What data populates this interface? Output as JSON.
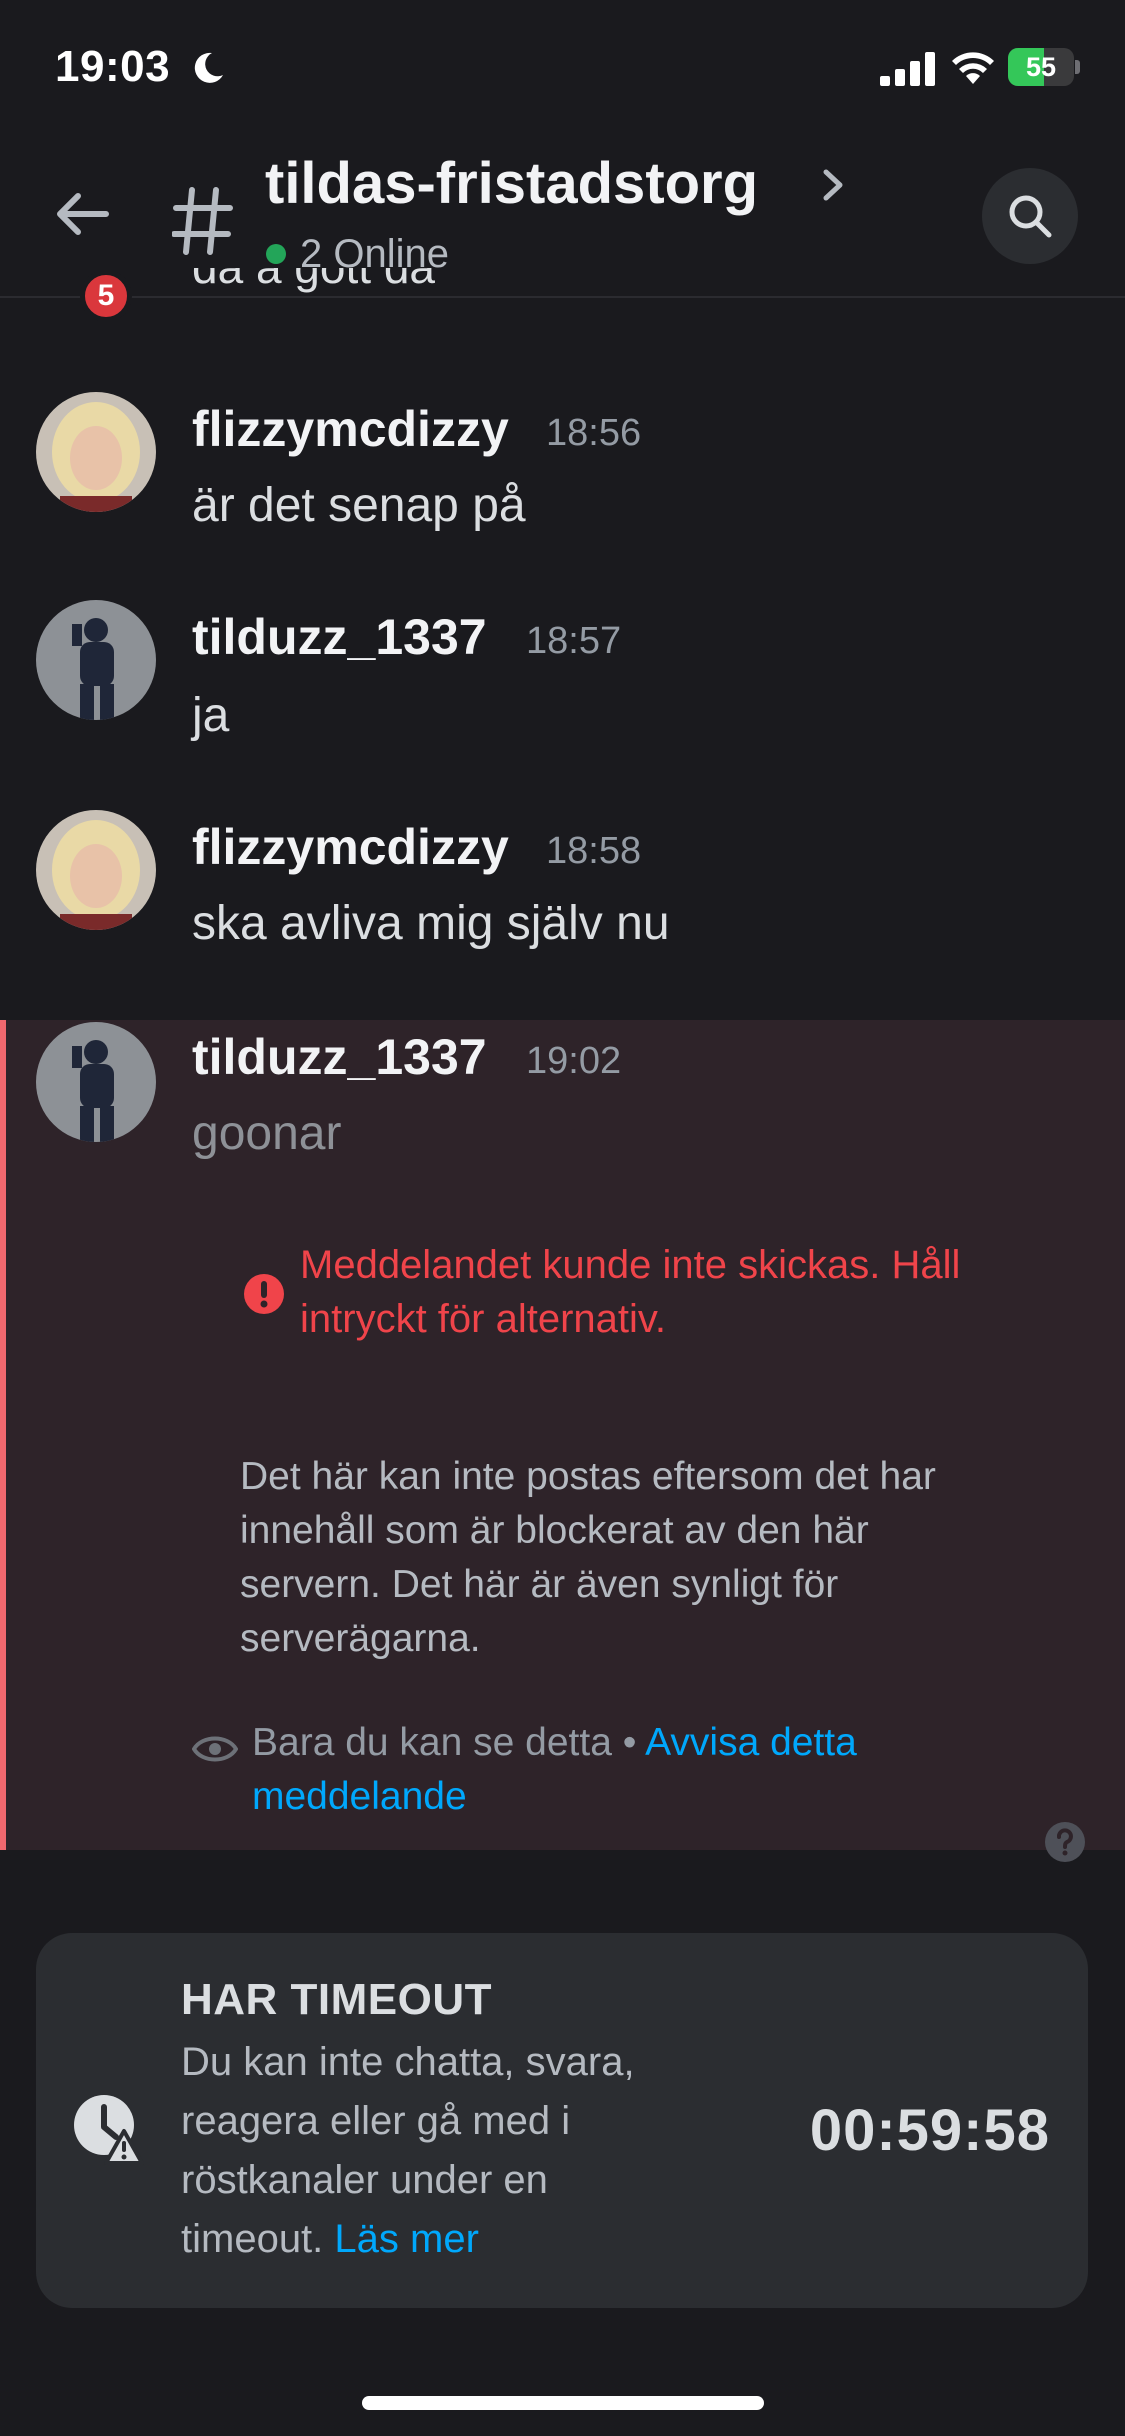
{
  "status_bar": {
    "time": "19:03",
    "battery_percent": "55",
    "battery_level": 0.55,
    "icons": [
      "moon-icon",
      "signal-icon",
      "wifi-icon",
      "battery-icon"
    ]
  },
  "header": {
    "badge_count": "5",
    "channel_name": "tildas-fristadstorg",
    "online_status": "2 Online",
    "colors": {
      "online": "#23a559",
      "badge": "#da373c"
    }
  },
  "messages": {
    "partial_text": "då å gött då",
    "items": [
      {
        "username": "flizzymcdizzy",
        "time": "18:56",
        "text": "är det senap på"
      },
      {
        "username": "tilduzz_1337",
        "time": "18:57",
        "text": "ja"
      },
      {
        "username": "flizzymcdizzy",
        "time": "18:58",
        "text": "ska avliva mig själv nu"
      }
    ],
    "failed": {
      "username": "tilduzz_1337",
      "time": "19:02",
      "text": "goonar",
      "error": "Meddelandet kunde inte skickas. Håll intryckt för alternativ.",
      "blocked_notice": "Det här kan inte postas eftersom det har innehåll som är blockerat av den här servern. Det här är även synligt för serverägarna.",
      "only_you": "Bara du kan se detta •",
      "dismiss_link": "Avvisa detta meddelande",
      "colors": {
        "error": "#f0444a",
        "link": "#00a8fc",
        "highlight_bar": "#f0686e"
      }
    }
  },
  "timeout": {
    "title": "HAR TIMEOUT",
    "description": "Du kan inte chatta, svara, reagera eller gå med i röstkanaler under en timeout.",
    "read_more": "Läs mer",
    "timer": "00:59:58"
  }
}
